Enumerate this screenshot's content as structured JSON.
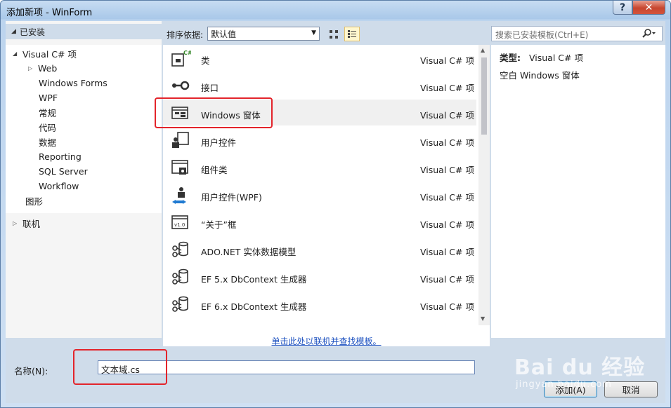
{
  "window": {
    "title": "添加新项 - WinForm",
    "help_label": "?",
    "close_label": "✕"
  },
  "left": {
    "header": "已安装",
    "tree": [
      {
        "label": "Visual C# 项",
        "expanded": true
      },
      {
        "label": "Web",
        "expanded": false
      },
      {
        "label": "Windows Forms"
      },
      {
        "label": "WPF"
      },
      {
        "label": "常规"
      },
      {
        "label": "代码"
      },
      {
        "label": "数据"
      },
      {
        "label": "Reporting"
      },
      {
        "label": "SQL Server"
      },
      {
        "label": "Workflow"
      },
      {
        "label": "图形"
      }
    ],
    "online": "联机"
  },
  "toolbar": {
    "sort_label": "排序依据:",
    "sort_value": "默认值"
  },
  "templates": [
    {
      "name": "类",
      "type": "Visual C# 项",
      "icon": "class-icon"
    },
    {
      "name": "接口",
      "type": "Visual C# 项",
      "icon": "interface-icon"
    },
    {
      "name": "Windows 窗体",
      "type": "Visual C# 项",
      "icon": "form-icon"
    },
    {
      "name": "用户控件",
      "type": "Visual C# 项",
      "icon": "user-control-icon"
    },
    {
      "name": "组件类",
      "type": "Visual C# 项",
      "icon": "component-icon"
    },
    {
      "name": "用户控件(WPF)",
      "type": "Visual C# 项",
      "icon": "wpf-user-control-icon"
    },
    {
      "name": "“关于”框",
      "type": "Visual C# 项",
      "icon": "about-box-icon"
    },
    {
      "name": "ADO.NET 实体数据模型",
      "type": "Visual C# 项",
      "icon": "entity-model-icon"
    },
    {
      "name": "EF 5.x DbContext 生成器",
      "type": "Visual C# 项",
      "icon": "dbcontext-icon"
    },
    {
      "name": "EF 6.x DbContext 生成器",
      "type": "Visual C# 项",
      "icon": "dbcontext-icon"
    }
  ],
  "online_link": "单击此处以联机并查找模板。",
  "search": {
    "placeholder": "搜索已安装模板(Ctrl+E)"
  },
  "details": {
    "type_label": "类型:",
    "type_value": "Visual C# 项",
    "description": "空白 Windows 窗体"
  },
  "name_field": {
    "label": "名称(N):",
    "value": "文本域.cs"
  },
  "buttons": {
    "add": "添加(A)",
    "cancel": "取消"
  },
  "watermark": {
    "main": "Bai du 经验",
    "sub": "jingyan.baidu.com"
  },
  "colors": {
    "highlight_box": "#e3242b",
    "link": "#1a4fbf"
  }
}
